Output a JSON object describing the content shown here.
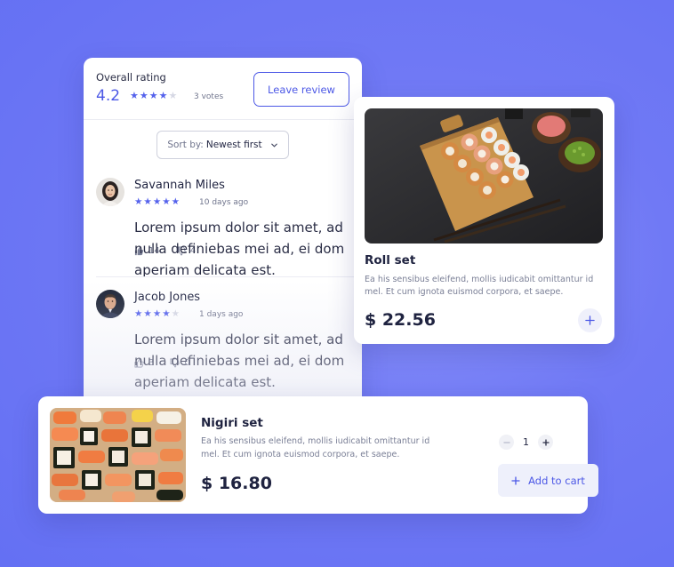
{
  "reviews": {
    "overall_label": "Overall rating",
    "overall_value": "4.2",
    "overall_rating_stars": 4,
    "votes_label": "3 votes",
    "leave_review_label": "Leave review",
    "sort_label": "Sort by:",
    "sort_value": "Newest first",
    "items": [
      {
        "name": "Savannah Miles",
        "stars": 5,
        "date": "10 days ago",
        "text_lines": [
          "Lorem ipsum dolor sit amet, ad",
          "nulla definiebas mei ad, ei dom",
          "aperiam delicata est."
        ],
        "likes": "14",
        "dislikes": "4"
      },
      {
        "name": "Jacob Jones",
        "stars": 4,
        "date": "1 days ago",
        "text_lines": [
          "Lorem ipsum dolor sit amet, ad",
          "nulla definiebas mei ad, ei dom",
          "aperiam delicata est."
        ],
        "likes": "3",
        "dislikes": "0"
      }
    ]
  },
  "roll": {
    "title": "Roll set",
    "description": "Ea his sensibus eleifend, mollis iudicabit omittantur id mel. Et cum ignota euismod corpora, et saepe.",
    "price": "$ 22.56",
    "image_icon": "sushi-roll-photo"
  },
  "nigiri": {
    "title": "Nigiri set",
    "description": "Ea his sensibus eleifend, mollis iudicabit omittantur id mel. Et cum ignota euismod corpora, et saepe.",
    "price": "$ 16.80",
    "quantity": "1",
    "add_to_cart_label": "Add to cart",
    "image_icon": "nigiri-photo"
  },
  "colors": {
    "background": "#6c76f4",
    "accent": "#4c58e6",
    "star": "#5562ec"
  }
}
